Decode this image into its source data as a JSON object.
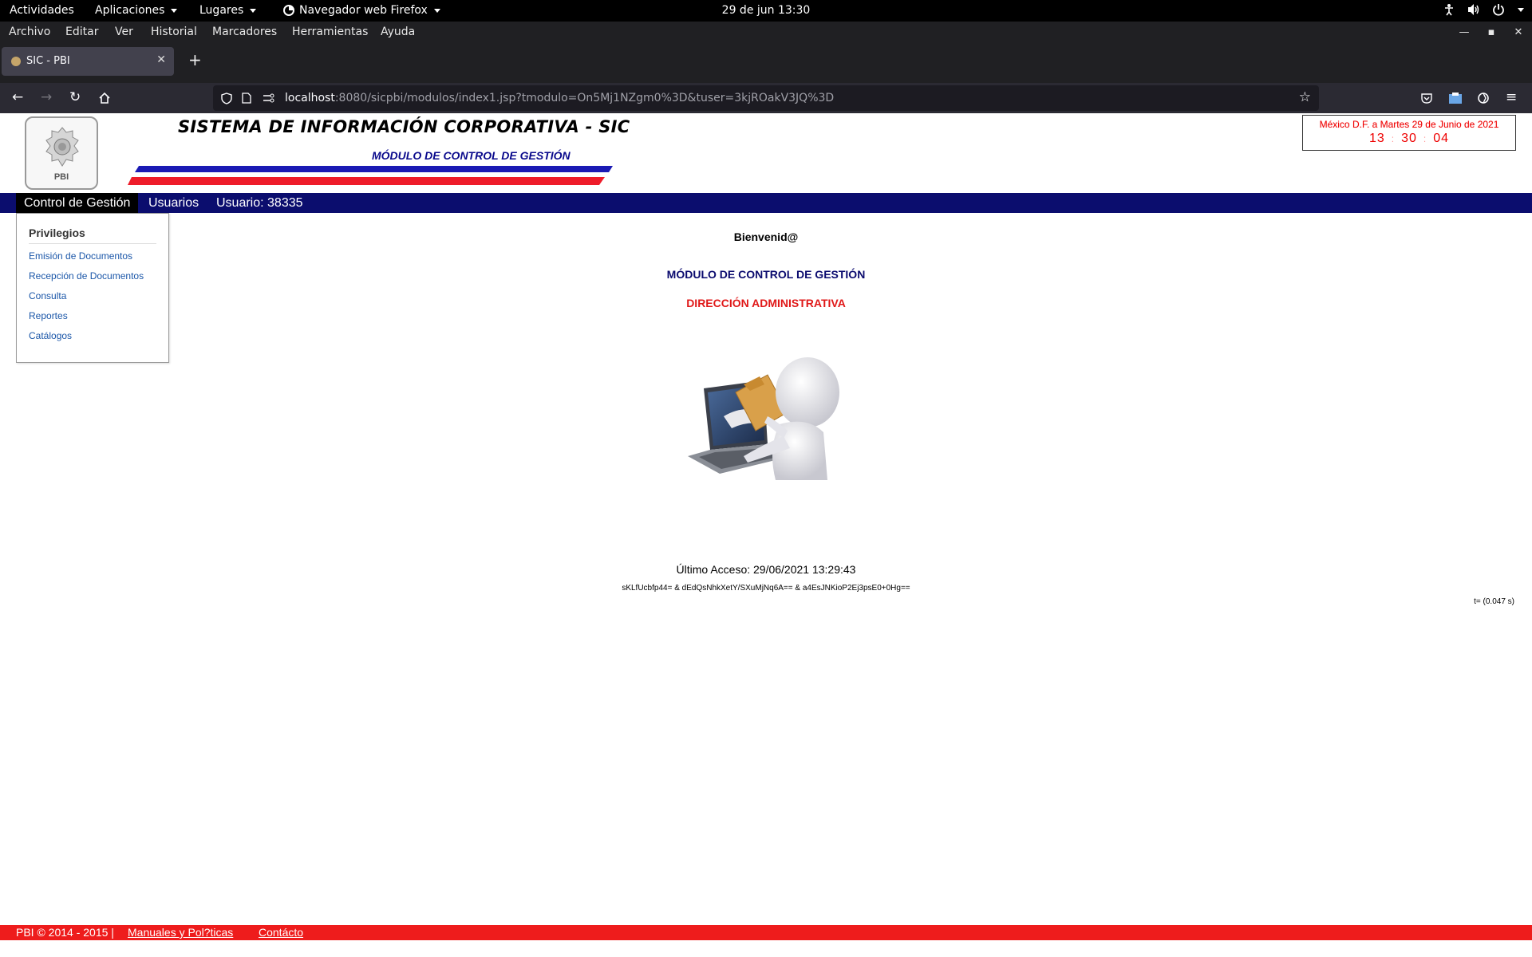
{
  "gnome": {
    "activities": "Actividades",
    "applications": "Aplicaciones",
    "places": "Lugares",
    "browser_app": "Navegador web Firefox",
    "clock": "29 de jun  13:30"
  },
  "firefox": {
    "menu": [
      "Archivo",
      "Editar",
      "Ver",
      "Historial",
      "Marcadores",
      "Herramientas",
      "Ayuda"
    ],
    "tab_title": "SIC - PBI",
    "url_host": "localhost",
    "url_rest": ":8080/sicpbi/modulos/index1.jsp?tmodulo=On5Mj1NZgm0%3D&tuser=3kjROakV3JQ%3D"
  },
  "header": {
    "logo_text": "PBI",
    "system_title": "SISTEMA DE INFORMACIÓN CORPORATIVA - SIC",
    "module_title": "MÓDULO DE CONTROL DE GESTIÓN",
    "date_text": "México D.F. a Martes 29 de Junio de 2021",
    "time": {
      "h": "13",
      "m": "30",
      "s": "04"
    },
    "colors": {
      "navy": "#0b0d6e",
      "red": "#ee1c1c"
    }
  },
  "nav": {
    "items": [
      "Control de Gestión",
      "Usuarios",
      "Usuario: 38335"
    ]
  },
  "dropdown": {
    "heading": "Privilegios",
    "links": [
      "Emisión de Documentos",
      "Recepción de Documentos",
      "Consulta",
      "Reportes",
      "Catálogos"
    ]
  },
  "main": {
    "welcome": "Bienvenid@",
    "module": "MÓDULO DE CONTROL DE GESTIÓN",
    "direction": "DIRECCIÓN ADMINISTRATIVA",
    "last_access": "Último Acceso: 29/06/2021 13:29:43",
    "tokens": "sKLfUcbfp44= & dEdQsNhkXetY/SXuMjNq6A== & a4EsJNKioP2Ej3psE0+0Hg==",
    "timing": "t= (0.047 s)"
  },
  "footer": {
    "copyright": "PBI © 2014 - 2015 |",
    "manuals": "Manuales y Pol?ticas",
    "contact": "Contácto"
  }
}
